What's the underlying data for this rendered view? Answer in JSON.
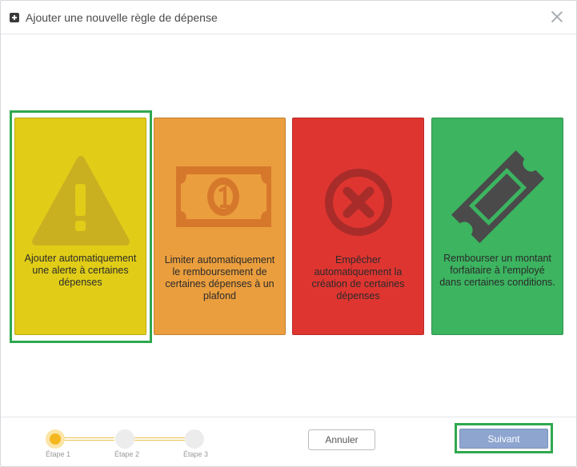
{
  "modal": {
    "title": "Ajouter une nouvelle règle de dépense"
  },
  "cards": [
    {
      "id": "alert",
      "text": "Ajouter automatiquement une alerte à certaines dépenses",
      "color": "#e1cd17",
      "icon": "warning-icon",
      "selected": true
    },
    {
      "id": "limit",
      "text": "Limiter automatiquement le remboursement de certaines dépenses à un plafond",
      "color": "#eb9e3d",
      "icon": "banknote-icon",
      "selected": false
    },
    {
      "id": "prevent",
      "text": "Empêcher automatiquement la création de certaines dépenses",
      "color": "#df3530",
      "icon": "forbidden-icon",
      "selected": false
    },
    {
      "id": "flat",
      "text": "Rembourser un montant forfaitaire à l'employé dans certaines conditions.",
      "color": "#3cb460",
      "icon": "ticket-icon",
      "selected": false
    }
  ],
  "stepper": {
    "current": 1,
    "steps": [
      "Étape 1",
      "Étape 2",
      "Étape 3"
    ]
  },
  "footer": {
    "cancel_label": "Annuler",
    "next_label": "Suivant"
  },
  "colors": {
    "selection_outline": "#2fa84f",
    "primary_button": "#8ea5cf",
    "step_active": "#f5b71f"
  }
}
